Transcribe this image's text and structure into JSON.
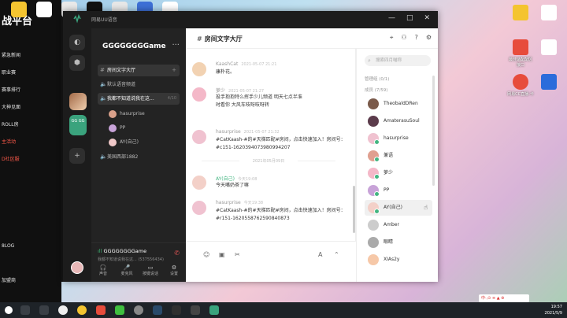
{
  "desktop": {
    "left_app_brand": "战平台",
    "left_app_menu": [
      "紧急新闻",
      "职业赛",
      "赛事排行",
      "大神见面",
      "ROLL房",
      "主活动",
      "D社区服",
      "",
      "",
      "",
      "",
      "8LOG",
      "",
      "加盟商",
      "自定义"
    ],
    "icons": [
      {
        "label": "",
        "color": "#f4c430"
      },
      {
        "label": "",
        "color": "#ffffff"
      },
      {
        "label": "最佳适配配区 接口",
        "color": "#e74c3c"
      },
      {
        "label": "",
        "color": "#ffffff"
      },
      {
        "label": "网易CC直播-卡",
        "color": "#e74c3c"
      },
      {
        "label": "",
        "color": "#2b6cdb"
      }
    ]
  },
  "window": {
    "title": "网易UU语音",
    "controls": {
      "minimize": "—",
      "maximize": "□",
      "close": "✕"
    }
  },
  "rail": {
    "gg_label": "GG GG",
    "add_label": "+"
  },
  "server": {
    "name": "GGGGGGGGame",
    "more": "···",
    "channels": [
      {
        "label": "房间文字大厅",
        "glyph": "#",
        "active": true,
        "extra": "+"
      },
      {
        "label": "默认语音频道",
        "glyph": "🔈",
        "active": false,
        "extra": ""
      },
      {
        "label": "我都不知道说我在这...",
        "glyph": "🔈",
        "active": false,
        "extra": "4/10"
      },
      {
        "label": "美国西部1882",
        "glyph": "🔈",
        "active": false,
        "extra": ""
      }
    ],
    "voice_members": [
      "hasurprise",
      "PP",
      "AY(自己)"
    ],
    "voice_status": {
      "signal": "ıll",
      "name": "GGGGGGGGame",
      "desc": "我都不知道说我在这... (537556434)",
      "hangup": "✆"
    },
    "bottom_actions": [
      {
        "icon": "🎧",
        "label": "声音"
      },
      {
        "icon": "🎤",
        "label": "麦克风"
      },
      {
        "icon": "▭",
        "label": "按键说话"
      },
      {
        "icon": "⚙",
        "label": "设置"
      }
    ]
  },
  "chat": {
    "title": "房间文字大厅",
    "header_icons": [
      "pin-icon",
      "members-icon",
      "help-icon",
      "settings-icon"
    ],
    "messages": [
      {
        "name": "KaashCat",
        "time": "2021-05-07 21:21",
        "text": "康朴花。",
        "green": false
      },
      {
        "name": "萝少",
        "time": "2021-05-07 21:27",
        "text": "投手抱抱特么挥手少儿频道 明天七点半准时看你 大风车吱呀吱呀转",
        "green": false
      },
      {
        "name": "hasurprise",
        "time": "2021-05-07 21:32",
        "text": "#CatKaash-#的#天梯匹配#房间，点击快速加入！房间号：#c151-1620394073980994207",
        "green": false
      },
      {
        "name": "AY(自己)",
        "time": "今天19:08",
        "text": "今天嘴奶茶了嘛",
        "green": true
      },
      {
        "name": "hasurprise",
        "time": "今天19:38",
        "text": "#CatKaash-#的#天梯匹配#房间，点击快速加入！房间号：#r151-1620558762590840873",
        "green": false
      }
    ],
    "date_divider": "2021年05月09日",
    "input_icons": [
      "emoji-icon",
      "image-icon",
      "scissors-icon",
      "font-icon",
      "expand-icon"
    ]
  },
  "members": {
    "search_placeholder": "搜索四月喵称",
    "admin_group": "管理组 (0/1)",
    "member_group": "成员 (7/59)",
    "list": [
      {
        "name": "TheobaldDRen",
        "online": false
      },
      {
        "name": "AmaterasuSoul",
        "online": false
      },
      {
        "name": "hasurprise",
        "online": true
      },
      {
        "name": "兼语",
        "online": true
      },
      {
        "name": "萝少",
        "online": true
      },
      {
        "name": "PP",
        "online": true
      },
      {
        "name": "AY(自己)",
        "online": true
      },
      {
        "name": "Amber",
        "online": false
      },
      {
        "name": "眼睛",
        "online": false
      },
      {
        "name": "XIAs2y",
        "online": false
      }
    ]
  },
  "taskbar": {
    "time": "19:57",
    "date": "2021/5/9",
    "ime": "中·,⊙ ≡ ▲ ⊕"
  }
}
